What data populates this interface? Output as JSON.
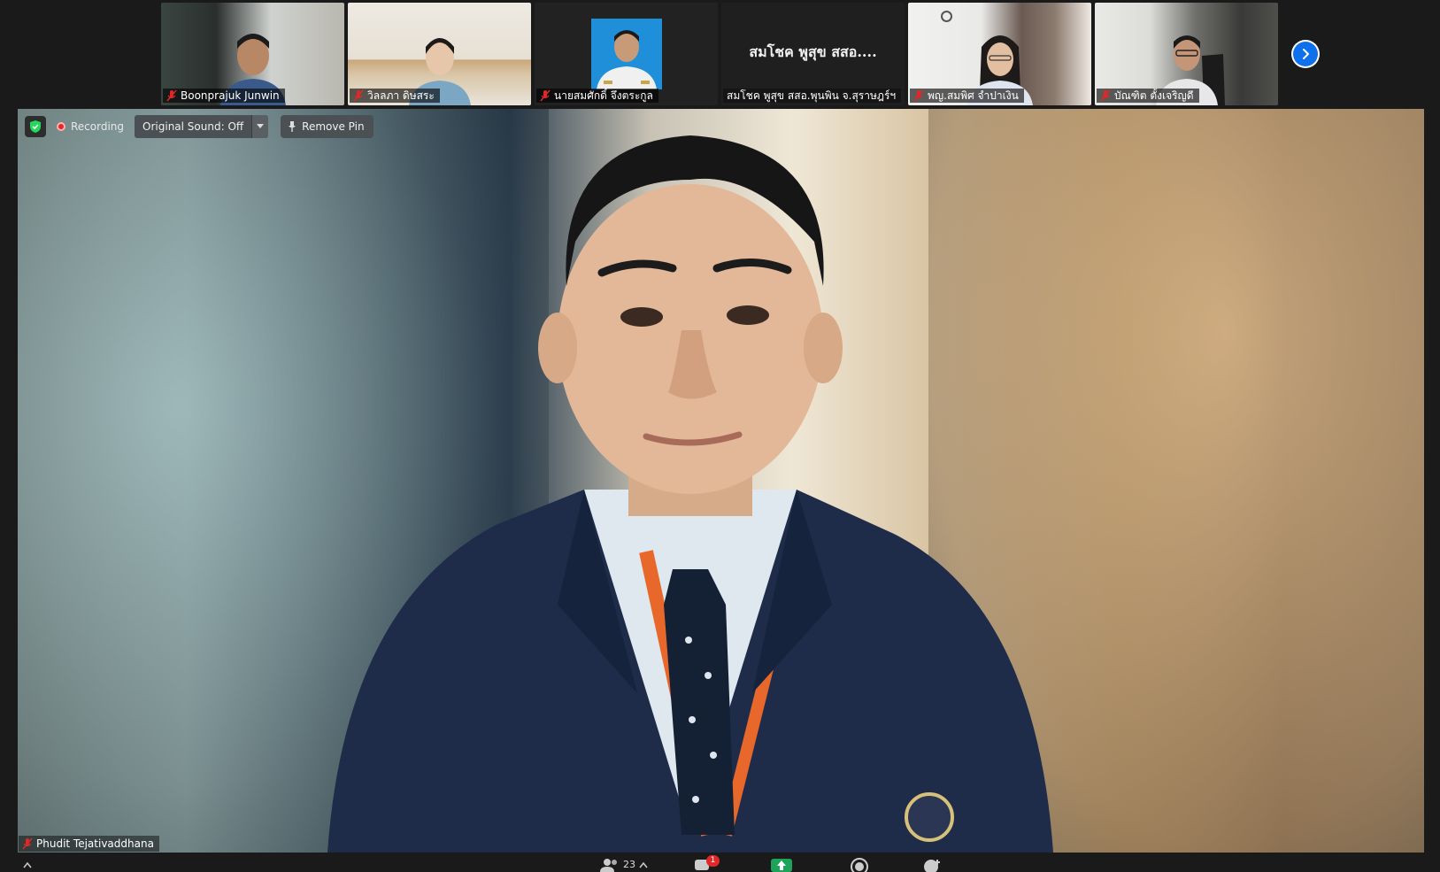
{
  "participants": [
    {
      "name": "Boonprajuk Junwin",
      "muted": true
    },
    {
      "name": "วิลลภา  ดิษสระ",
      "muted": true
    },
    {
      "name": "นายสมศักดิ์ จึงตระกูล",
      "muted": true
    },
    {
      "name": "สมโชค พูสุข สสอ.พุนพิน จ.สุราษฎร์ฯ",
      "display_label": "สมโชค พูสุข สสอ....",
      "muted": false
    },
    {
      "name": "พญ.สมพิศ จำปาเงิน",
      "muted": true
    },
    {
      "name": "บัณฑิต ตั้งเจริญดี",
      "muted": true
    }
  ],
  "main_video": {
    "speaker_name": "Phudit Tejativaddhana",
    "muted": true
  },
  "controls": {
    "recording_label": "Recording",
    "original_sound_label": "Original Sound: Off",
    "remove_pin_label": "Remove Pin"
  },
  "toolbar": {
    "participants_count": "23",
    "chat_badge": "1"
  },
  "colors": {
    "accent_blue": "#0e71eb",
    "recording_red": "#e02828",
    "mute_red": "#e02828",
    "security_green": "#23d959",
    "share_green": "#1ea45a"
  },
  "icons": [
    "microphone-muted-icon",
    "shield-check-icon",
    "record-icon",
    "chevron-down-icon",
    "pin-icon",
    "chevron-right-icon",
    "participants-icon",
    "chat-icon",
    "share-screen-icon",
    "record-button-icon",
    "reactions-icon"
  ]
}
